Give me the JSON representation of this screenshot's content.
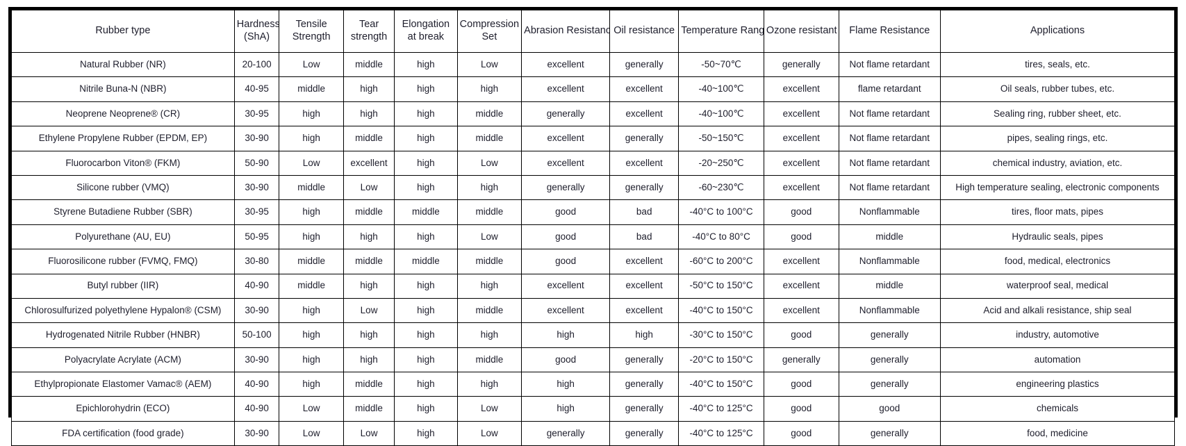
{
  "table": {
    "columns": [
      "Rubber type",
      "Hardness (ShA)",
      "Tensile Strength",
      "Tear strength",
      "Elongation at break",
      "Compression Set",
      "Abrasion Resistance",
      "Oil resistance",
      "Temperature Range",
      "Ozone resistant",
      "Flame Resistance",
      "Applications"
    ],
    "columns_lines": [
      [
        "Rubber type"
      ],
      [
        "Hardness",
        "(ShA)"
      ],
      [
        "Tensile",
        "Strength"
      ],
      [
        "Tear",
        "strength"
      ],
      [
        "Elongation",
        "at break"
      ],
      [
        "Compression",
        "Set"
      ],
      [
        "Abrasion Resistance"
      ],
      [
        "Oil resistance"
      ],
      [
        "Temperature Range"
      ],
      [
        "Ozone resistant"
      ],
      [
        "Flame Resistance"
      ],
      [
        "Applications"
      ]
    ],
    "rows": [
      {
        "type": "Natural Rubber (NR)",
        "hardness": "20-100",
        "tensile": "Low",
        "tear": "middle",
        "elongation": "high",
        "compression": "Low",
        "abrasion": "excellent",
        "oil": "generally",
        "temperature": "-50~70℃",
        "ozone": "generally",
        "flame": "Not flame retardant",
        "applications": "tires, seals, etc."
      },
      {
        "type": "Nitrile Buna-N (NBR)",
        "hardness": "40-95",
        "tensile": "middle",
        "tear": "high",
        "elongation": "high",
        "compression": "high",
        "abrasion": "excellent",
        "oil": "excellent",
        "temperature": "-40~100℃",
        "ozone": "excellent",
        "flame": "flame retardant",
        "applications": "Oil seals, rubber tubes, etc."
      },
      {
        "type": "Neoprene Neoprene® (CR)",
        "hardness": "30-95",
        "tensile": "high",
        "tear": "high",
        "elongation": "high",
        "compression": "middle",
        "abrasion": "generally",
        "oil": "excellent",
        "temperature": "-40~100℃",
        "ozone": "excellent",
        "flame": "Not flame retardant",
        "applications": "Sealing ring, rubber sheet, etc."
      },
      {
        "type": "Ethylene Propylene Rubber (EPDM, EP)",
        "hardness": "30-90",
        "tensile": "high",
        "tear": "middle",
        "elongation": "high",
        "compression": "middle",
        "abrasion": "excellent",
        "oil": "generally",
        "temperature": "-50~150℃",
        "ozone": "excellent",
        "flame": "Not flame retardant",
        "applications": "pipes, sealing rings, etc."
      },
      {
        "type": "Fluorocarbon Viton® (FKM)",
        "hardness": "50-90",
        "tensile": "Low",
        "tear": "excellent",
        "elongation": "high",
        "compression": "Low",
        "abrasion": "excellent",
        "oil": "excellent",
        "temperature": "-20~250℃",
        "ozone": "excellent",
        "flame": "Not flame retardant",
        "applications": "chemical industry, aviation, etc."
      },
      {
        "type": "Silicone rubber (VMQ)",
        "hardness": "30-90",
        "tensile": "middle",
        "tear": "Low",
        "elongation": "high",
        "compression": "high",
        "abrasion": "generally",
        "oil": "generally",
        "temperature": "-60~230℃",
        "ozone": "excellent",
        "flame": "Not flame retardant",
        "applications": "High temperature sealing, electronic components"
      },
      {
        "type": "Styrene Butadiene Rubber (SBR)",
        "hardness": "30-95",
        "tensile": "high",
        "tear": "middle",
        "elongation": "middle",
        "compression": "middle",
        "abrasion": "good",
        "oil": "bad",
        "temperature": "-40°C to 100°C",
        "ozone": "good",
        "flame": "Nonflammable",
        "applications": "tires, floor mats, pipes"
      },
      {
        "type": "Polyurethane (AU, EU)",
        "hardness": "50-95",
        "tensile": "high",
        "tear": "high",
        "elongation": "high",
        "compression": "Low",
        "abrasion": "good",
        "oil": "bad",
        "temperature": "-40°C to 80°C",
        "ozone": "good",
        "flame": "middle",
        "applications": "Hydraulic seals, pipes"
      },
      {
        "type": "Fluorosilicone rubber (FVMQ, FMQ)",
        "hardness": "30-80",
        "tensile": "middle",
        "tear": "middle",
        "elongation": "middle",
        "compression": "middle",
        "abrasion": "good",
        "oil": "excellent",
        "temperature": "-60°C to 200°C",
        "ozone": "excellent",
        "flame": "Nonflammable",
        "applications": "food, medical, electronics"
      },
      {
        "type": "Butyl rubber (IIR)",
        "hardness": "40-90",
        "tensile": "middle",
        "tear": "high",
        "elongation": "high",
        "compression": "high",
        "abrasion": "excellent",
        "oil": "excellent",
        "temperature": "-50°C to 150°C",
        "ozone": "excellent",
        "flame": "middle",
        "applications": "waterproof seal, medical"
      },
      {
        "type": "Chlorosulfurized polyethylene Hypalon® (CSM)",
        "hardness": "30-90",
        "tensile": "high",
        "tear": "Low",
        "elongation": "high",
        "compression": "middle",
        "abrasion": "excellent",
        "oil": "excellent",
        "temperature": "-40°C to 150°C",
        "ozone": "excellent",
        "flame": "Nonflammable",
        "applications": "Acid and alkali resistance, ship seal"
      },
      {
        "type": "Hydrogenated Nitrile Rubber (HNBR)",
        "hardness": "50-100",
        "tensile": "high",
        "tear": "high",
        "elongation": "high",
        "compression": "high",
        "abrasion": "high",
        "oil": "high",
        "temperature": "-30°C to 150°C",
        "ozone": "good",
        "flame": "generally",
        "applications": "industry, automotive"
      },
      {
        "type": "Polyacrylate Acrylate (ACM)",
        "hardness": "30-90",
        "tensile": "high",
        "tear": "high",
        "elongation": "high",
        "compression": "middle",
        "abrasion": "good",
        "oil": "generally",
        "temperature": "-20°C to 150°C",
        "ozone": "generally",
        "flame": "generally",
        "applications": "automation"
      },
      {
        "type": "Ethylpropionate Elastomer Vamac® (AEM)",
        "hardness": "40-90",
        "tensile": "high",
        "tear": "middle",
        "elongation": "high",
        "compression": "high",
        "abrasion": "high",
        "oil": "generally",
        "temperature": "-40°C to 150°C",
        "ozone": "good",
        "flame": "generally",
        "applications": "engineering plastics"
      },
      {
        "type": "Epichlorohydrin (ECO)",
        "hardness": "40-90",
        "tensile": "Low",
        "tear": "middle",
        "elongation": "high",
        "compression": "Low",
        "abrasion": "high",
        "oil": "generally",
        "temperature": "-40°C to 125°C",
        "ozone": "good",
        "flame": "good",
        "applications": "chemicals"
      },
      {
        "type": "FDA certification (food grade)",
        "hardness": "30-90",
        "tensile": "Low",
        "tear": "Low",
        "elongation": "high",
        "compression": "Low",
        "abrasion": "generally",
        "oil": "generally",
        "temperature": "-40°C to 125°C",
        "ozone": "good",
        "flame": "generally",
        "applications": "food, medicine"
      }
    ]
  }
}
